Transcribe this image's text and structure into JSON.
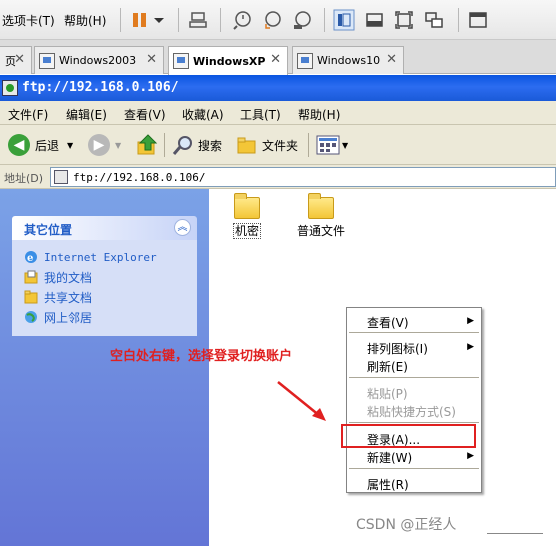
{
  "vmware": {
    "menu": [
      "选项卡(T)",
      "帮助(H)"
    ]
  },
  "tabs": [
    {
      "label": "Windows2003",
      "close": "✕"
    },
    {
      "label": "WindowsXP",
      "close": "✕"
    },
    {
      "label": "Windows10",
      "close": "✕"
    }
  ],
  "explorer": {
    "title": "ftp://192.168.0.106/",
    "menu": [
      "文件(F)",
      "编辑(E)",
      "查看(V)",
      "收藏(A)",
      "工具(T)",
      "帮助(H)"
    ],
    "toolbar": {
      "back": "后退",
      "search": "搜索",
      "folders": "文件夹"
    },
    "address": {
      "label": "地址(D)",
      "value": "ftp://192.168.0.106/"
    }
  },
  "sidebar": {
    "heading": "其它位置",
    "links": [
      "Internet Explorer",
      "我的文档",
      "共享文档",
      "网上邻居"
    ]
  },
  "folders": [
    "机密",
    "普通文件"
  ],
  "annotation": "空白处右键，选择登录切换账户",
  "context_menu": {
    "view": "查看(V)",
    "arrange": "排列图标(I)",
    "refresh": "刷新(E)",
    "paste": "粘贴(P)",
    "paste_shortcut": "粘贴快捷方式(S)",
    "login": "登录(A)...",
    "new": "新建(W)",
    "properties": "属性(R)"
  },
  "watermark": "CSDN @正经人",
  "colors": {
    "xp_blue": "#0a55e0",
    "annotation_red": "#e02020",
    "panel_link": "#215dc6"
  }
}
